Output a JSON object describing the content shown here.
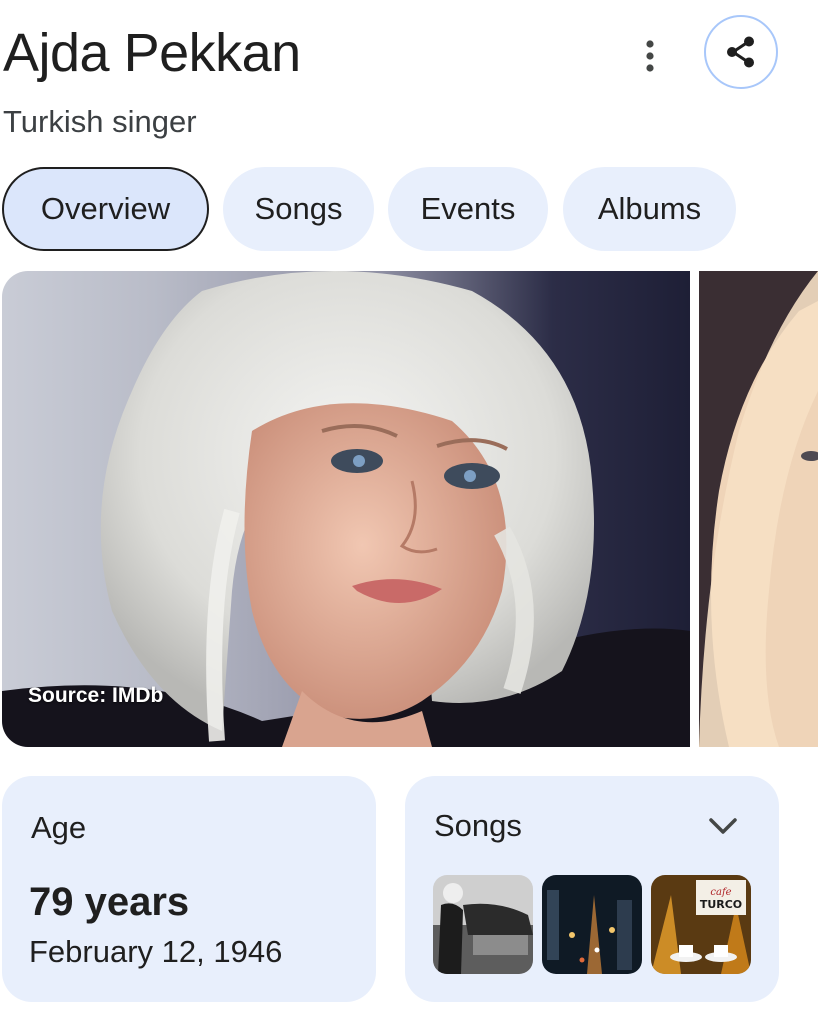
{
  "header": {
    "title": "Ajda Pekkan",
    "subtitle": "Turkish singer",
    "more_icon": "more-vert-icon",
    "share_icon": "share-icon"
  },
  "tabs": [
    {
      "label": "Overview",
      "active": true
    },
    {
      "label": "Songs",
      "active": false
    },
    {
      "label": "Events",
      "active": false
    },
    {
      "label": "Albums",
      "active": false
    }
  ],
  "gallery": {
    "main_source": "Source: IMDb"
  },
  "age_card": {
    "label": "Age",
    "value": "79 years",
    "birth_date": "February 12, 1946"
  },
  "songs_card": {
    "label": "Songs",
    "expand_icon": "chevron-down-icon",
    "thumbnail_3_text": "cafe TURCO"
  },
  "colors": {
    "tab_bg": "#e8effc",
    "tab_active_bg": "#dbe6fb",
    "share_border": "#a8c7fa",
    "card_bg": "#e8effc"
  }
}
